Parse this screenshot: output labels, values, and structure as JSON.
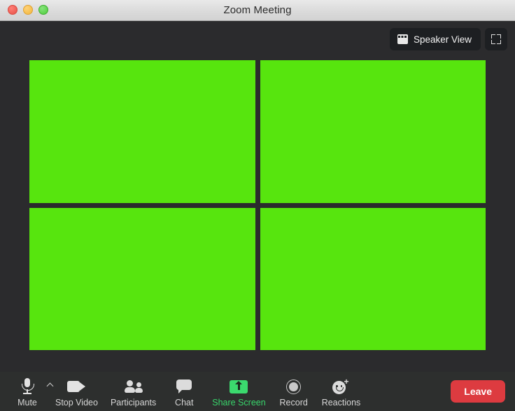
{
  "window": {
    "title": "Zoom Meeting",
    "controls": {
      "close": "close-button",
      "minimize": "minimize-button",
      "maximize": "maximize-button"
    }
  },
  "view_controls": {
    "speaker_view_label": "Speaker View",
    "speaker_view_icon": "grid-layout-icon",
    "fullscreen_icon": "fullscreen-expand-icon"
  },
  "stage": {
    "background_color": "#2b2b2d",
    "tile_color": "#57e50e",
    "tiles": [
      {
        "id": "participant-tile-1"
      },
      {
        "id": "participant-tile-2"
      },
      {
        "id": "participant-tile-3"
      },
      {
        "id": "participant-tile-4"
      }
    ]
  },
  "toolbar": {
    "background_color": "#2d2f2e",
    "accent_color": "#38d66b",
    "items": [
      {
        "label": "Mute",
        "icon": "microphone-icon",
        "accent": false,
        "has_caret": true
      },
      {
        "label": "Stop Video",
        "icon": "video-camera-icon",
        "accent": false,
        "has_caret": false
      },
      {
        "label": "Participants",
        "icon": "people-icon",
        "accent": false,
        "has_caret": false
      },
      {
        "label": "Chat",
        "icon": "chat-bubble-icon",
        "accent": false,
        "has_caret": false
      },
      {
        "label": "Share Screen",
        "icon": "share-screen-icon",
        "accent": true,
        "has_caret": false
      },
      {
        "label": "Record",
        "icon": "record-icon",
        "accent": false,
        "has_caret": false
      },
      {
        "label": "Reactions",
        "icon": "reactions-icon",
        "accent": false,
        "has_caret": false
      }
    ],
    "leave_label": "Leave",
    "leave_color": "#dd3b40"
  }
}
